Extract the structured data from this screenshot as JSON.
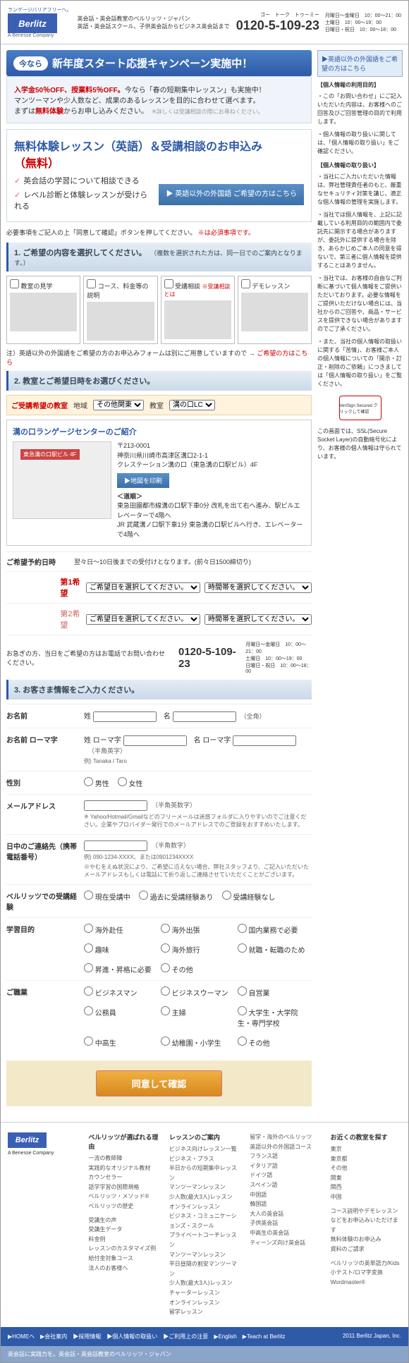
{
  "header": {
    "logo": "Berlitz",
    "logo_tagline": "ランゲージバリアフリーへ。",
    "logo_sub": "A Benesse Company",
    "text1": "英会話・英会話教室のベルリッツ・ジャパン",
    "text2": "英語・英会話スクール、子供英会話からビジネス英会話まで",
    "phone_kana": "ゴー　トーク　トゥーミー",
    "phone": "0120-5-109-23",
    "hours1": "月曜日～金曜日　10：00～21：00",
    "hours2": "土曜日　10：00～19：00",
    "hours3": "日曜日・祝日　10：00～18：00"
  },
  "sidebar": {
    "link": "▶英語以外の外国語をご希望の方はこちら",
    "block1_title": "【個人情報の利用目的】",
    "block1_items": [
      "・この「お問い合わせ」にご記入いただいた内容は、お客様へのご回答及びご回答管理の目的で利用します。",
      "・個人情報の取り扱いに関しては、「個人情報の取り扱い」をご確認ください。"
    ],
    "block2_title": "【個人情報の取り扱い】",
    "block2_items": [
      "・当社にご入力いただいた情報は、弊社管理責任者のもと、厳重なセキュリティ対策を講じ、適正な個人情報の管理を実施します。",
      "・当社では個人情報を、上記に記載している利用目的の範囲内で委託先に開示する場合がありますが、委託外に提供する場合を除き、あらかじめご本人の同意を得ないで、第三者に個人情報を提供することはありません。",
      "・当社では、お客様の自由なご判断に基づいて個人情報をご提供いただいております。必要な情報をご提供いただけない場合には、当社からのご回答や、商品・サービスを提供できない場合がありますのでご了承ください。",
      "・また、当社の個人情報の取扱いに関する「苦情」、お客様ご本人の個人情報についての「開示・訂正・削除のご依頼」につきましては「個人情報の取り扱い」をご覧ください。"
    ],
    "verisign": "VeriSign Secured クリックして確認",
    "ssl_note": "この画面では、SSL(Secure Socket Layer)の自動暗号化により、お客様の個人情報は守られています。"
  },
  "banner": {
    "tag": "今なら",
    "text": "新年度スタート応援キャンペーン実施中！"
  },
  "promo": {
    "line1a": "入学金50％OFF、授業料5％OFF。",
    "line1b": "今なら「春の短期集中レッスン」も実施中！",
    "line2": "マンツーマンや少人数など、成果のあるレッスンを目的に合わせて選べます。",
    "line3a": "まずは",
    "line3b": "無料体験",
    "line3c": "からお申し込みください。",
    "small": "※詳しくは受講相談の際にお尋ねください。"
  },
  "apply": {
    "title1": "無料体験レッスン（英語）＆受講相談のお申込み",
    "title2": "（無料）",
    "item1": "英会話の学習について相談できる",
    "item2": "レベル診断と体験レッスンが受けられる",
    "btn": "▶ 英語以外の外国語\nご希望の方はこちら"
  },
  "note1": "必要事項をご記入の上「同意して確認」ボタンを押してください。",
  "note1b": "※は必須事項です。",
  "sec1": {
    "title": "1. ご希望の内容を選択してください。",
    "sub": "（複数を選択された方は、同一日でのご案内となります。）"
  },
  "options": [
    {
      "label": "教室の見学"
    },
    {
      "label": "コース、料金等の説明"
    },
    {
      "label": "受講相談",
      "note": "※受講相談とは"
    },
    {
      "label": "デモレッスン"
    }
  ],
  "note2": "注）英語以外の外国語をご希望の方のお申込みフォームは別にご用意していますので → ",
  "note2_link": "ご希望の方はこちら",
  "sec2": {
    "title": "2. 教室とご希望日時をお選びください。"
  },
  "room": {
    "label": "ご受講希望の教室",
    "region_label": "地域",
    "region_value": "その他関東",
    "school_label": "教室",
    "school_value": "溝の口LC"
  },
  "school": {
    "title": "溝の口ランゲージセンターのご紹介",
    "map_label": "東急溝の口駅ビル 4F",
    "zip": "〒213-0001",
    "addr": "神奈川県川崎市高津区溝口2-1-1",
    "building": "クレステーション溝の口（東急溝の口駅ビル）4F",
    "btn": "▶地図を印刷",
    "access_title": "＜道順＞",
    "access1": "東急田園都市線溝の口駅下車0分 改札を出て右へ進み、駅ビルエレベーターで4階へ",
    "access2": "JR 武蔵溝ノ口駅下車1分 東急溝の口駅ビルへ行き、エレベーターで4階へ"
  },
  "schedule": {
    "label": "ご希望予約日時",
    "note": "翌々日～10日後までの受付けとなります。(前々日1500締切り)",
    "pref1": "第1希望",
    "pref2": "第2希望",
    "date_ph": "ご希望日を選択してください。",
    "time_ph": "時間帯を選択してください。"
  },
  "contact": {
    "text": "お急ぎの方、当日をご希望の方はお電話でお問い合わせください。"
  },
  "sec3": {
    "title": "3. お客さま情報をご入力ください。"
  },
  "form": {
    "name": {
      "label": "お名前",
      "sei": "姓",
      "mei": "名",
      "hint": "（全角）"
    },
    "name_roma": {
      "label": "お名前 ローマ字",
      "sei": "姓 ローマ字",
      "mei": "名 ローマ字",
      "hint": "（半角英字）",
      "example": "例) Tanaka / Taro"
    },
    "gender": {
      "label": "性別",
      "male": "男性",
      "female": "女性"
    },
    "email": {
      "label": "メールアドレス",
      "hint": "（半角英数字）",
      "note": "※ Yahoo/Hotmail/Gmailなどのフリーメールは迷惑フォルダに入りやすいのでご注意ください。企業やプロバイダー発行でのメールアドレスでのご登録をおすすめいたします。"
    },
    "phone": {
      "label": "日中のご連絡先（携帯電話番号）",
      "hint": "（半角数字）",
      "example": "例) 090-1234-XXXX、または0901234XXXX",
      "note": "※やむをえぬ状況により、ご希望に沿えない場合、弊社スタッフより、ご記入いただいたメールアドレスもしくは電話にて折り返しご連絡させていただくことがございます。"
    },
    "berlitz_exp": {
      "label": "ベルリッツでの受講経験",
      "opt1": "現在受講中",
      "opt2": "過去に受講経験あり",
      "opt3": "受講経験なし"
    },
    "purpose": {
      "label": "学習目的",
      "opts": [
        "海外赴任",
        "海外出張",
        "国内業務で必要",
        "趣味",
        "海外旅行",
        "就職・転職のため",
        "昇進・昇格に必要",
        "その他"
      ]
    },
    "occupation": {
      "label": "ご職業",
      "opts": [
        "ビジネスマン",
        "ビジネスウーマン",
        "自営業",
        "公務員",
        "主婦",
        "大学生・大学院生・専門学校",
        "中高生",
        "幼稚園・小学生",
        "その他"
      ]
    }
  },
  "submit": "同意して確認",
  "footer": {
    "col1_title": "ベルリッツが選ばれる理由",
    "col1": [
      "一流の教師陣",
      "実践的なオリジナル教材",
      "カウンセラー",
      "語学学習の国際規格",
      "ベルリッツ・メソッド®",
      "ベルリッツの歴史"
    ],
    "col1b": [
      "受講生の声",
      "受講生データ",
      "料金例",
      "レッスンのカスタマイズ例",
      "給付金対象コース",
      "法人のお客様へ"
    ],
    "col2_title": "レッスンのご案内",
    "col2": [
      "ビジネス向けレッスン一覧",
      "ビジネス・プラス",
      "半日からの短期集中レッスン",
      "マンツーマンレッスン",
      "少人数(最大3人)レッスン",
      "オンラインレッスン",
      "ビジネス・コミュニケーションズ・スクール",
      "プライベートコーチレッスン",
      "マンツーマンレッスン",
      "平日昼間の割安マンツーマン",
      "少人数(最大3人)レッスン",
      "チャーターレッスン",
      "オンラインレッスン",
      "留学レッスン"
    ],
    "col3": [
      "留学・海外のベルリッツ",
      "英語以外の外国語コース",
      "フランス語",
      "イタリア語",
      "ドイツ語",
      "スペイン語",
      "中国語",
      "韓国語",
      "大人の英会話",
      "子供英会話",
      "中高生の英会話",
      "ティーンズ向け英会話"
    ],
    "col4_title": "お近くの教室を探す",
    "col4": [
      "東京",
      "東京都",
      "その他",
      "関東",
      "関西",
      "中国"
    ],
    "col4b": [
      "コース説明やデモレッスンなどをお申込みいただけます",
      "無料体験のお申込み",
      "資料のご請求"
    ],
    "col4c": [
      "ベルリッツの英単語力/Kids小テスト/ロマ字変換",
      "Wordmaster®"
    ],
    "bar_links": [
      "HOMEへ",
      "会社案内",
      "採用情報",
      "個人情報の取扱い",
      "ご利用上の注意",
      "English",
      "Teach at Berlitz"
    ],
    "copyright": "2011 Berlitz Japan, Inc.",
    "tagline": "英会話に実践力を。英会話・英会話教室のベルリッツ・ジャパン"
  }
}
